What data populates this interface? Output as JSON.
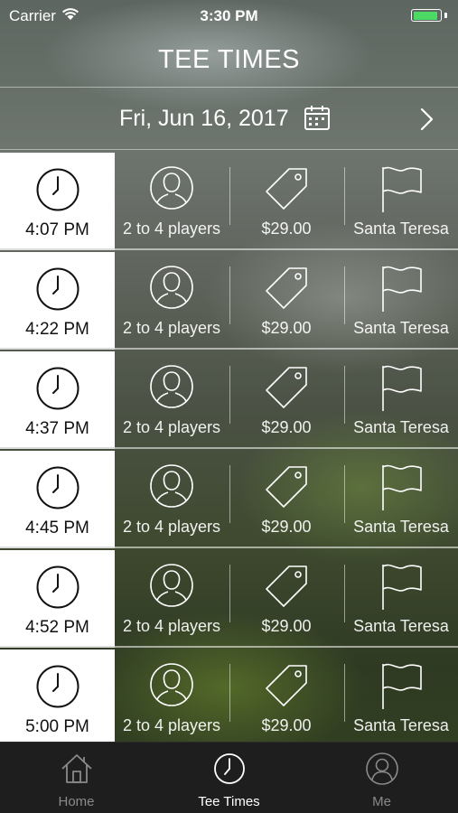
{
  "status_bar": {
    "carrier": "Carrier",
    "time": "3:30 PM",
    "battery_level": 0.9,
    "battery_color": "#4cd964"
  },
  "header": {
    "title": "TEE TIMES"
  },
  "date_bar": {
    "date": "Fri, Jun 16, 2017",
    "calendar_icon": "calendar-icon",
    "next_icon": "chevron-right-icon"
  },
  "tee_times": [
    {
      "time": "4:07 PM",
      "players": "2 to 4 players",
      "price": "$29.00",
      "course": "Santa Teresa"
    },
    {
      "time": "4:22 PM",
      "players": "2 to 4 players",
      "price": "$29.00",
      "course": "Santa Teresa"
    },
    {
      "time": "4:37 PM",
      "players": "2 to 4 players",
      "price": "$29.00",
      "course": "Santa Teresa"
    },
    {
      "time": "4:45 PM",
      "players": "2 to 4 players",
      "price": "$29.00",
      "course": "Santa Teresa"
    },
    {
      "time": "4:52 PM",
      "players": "2 to 4 players",
      "price": "$29.00",
      "course": "Santa Teresa"
    },
    {
      "time": "5:00 PM",
      "players": "2 to 4 players",
      "price": "$29.00",
      "course": "Santa Teresa"
    }
  ],
  "tabs": [
    {
      "label": "Home",
      "icon": "home-icon",
      "active": false
    },
    {
      "label": "Tee Times",
      "icon": "clock-icon",
      "active": true
    },
    {
      "label": "Me",
      "icon": "person-icon",
      "active": false
    }
  ]
}
